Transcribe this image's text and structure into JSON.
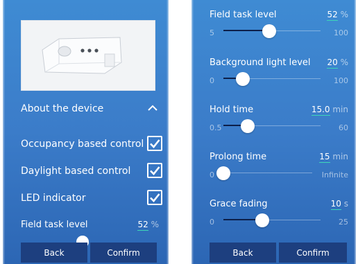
{
  "left_screen": {
    "about_label": "About the device",
    "toggles": [
      {
        "label": "Occupancy based control",
        "checked": true
      },
      {
        "label": "Daylight based control",
        "checked": true
      },
      {
        "label": "LED indicator",
        "checked": true
      }
    ],
    "peek": {
      "title": "Field task level",
      "value": "52",
      "unit": "%"
    },
    "back_label": "Back",
    "confirm_label": "Confirm"
  },
  "right_screen": {
    "settings": [
      {
        "title": "Field task level",
        "value": "52",
        "unit": "%",
        "min": "5",
        "max": "100",
        "level": 0.47
      },
      {
        "title": "Background light level",
        "value": "20",
        "unit": "%",
        "min": "0",
        "max": "100",
        "level": 0.2
      },
      {
        "title": "Hold time",
        "value": "15.0",
        "unit": "min",
        "min": "0.5",
        "max": "60",
        "level": 0.25
      },
      {
        "title": "Prolong time",
        "value": "15",
        "unit": "min",
        "min": "0",
        "max": "Infinite",
        "level": 0.0
      },
      {
        "title": "Grace fading",
        "value": "10",
        "unit": "s",
        "min": "0",
        "max": "25",
        "level": 0.4
      }
    ],
    "back_label": "Back",
    "confirm_label": "Confirm"
  },
  "colors": {
    "background_top": "#3f8bd3",
    "background_bottom": "#2c66b4",
    "button": "#1d3f7f",
    "slider_fill": "#0c1f49",
    "value_underline": "#3dd6b8"
  }
}
